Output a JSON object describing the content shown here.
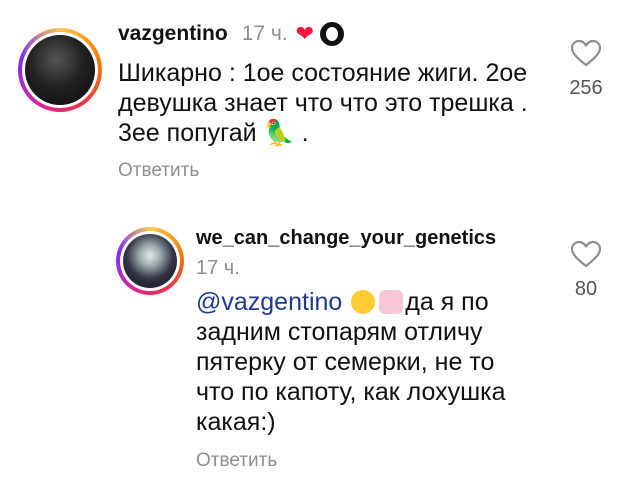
{
  "comments": [
    {
      "username": "vazgentino",
      "time": "17 ч.",
      "text_line1": "Шикарно : 1ое состояние жиги. 2ое",
      "text_line2": "девушка знает что что это трешка   .",
      "text_line3": "3ее попугай 🦜 .",
      "reply_label": "Ответить",
      "likes": "256",
      "badges": [
        "heart-icon",
        "face-icon"
      ]
    },
    {
      "username": "we_can_change_your_genetics",
      "time": "17 ч.",
      "mention": "@vazgentino",
      "text_after_mention": "да я по",
      "text_line2": "задним стопарям отличу",
      "text_line3": "пятерку от семерки, не то",
      "text_line4": "что по капоту, как лохушка",
      "text_line5": "какая:)",
      "reply_label": "Ответить",
      "likes": "80"
    }
  ],
  "colors": {
    "mention": "#1f3b8c",
    "muted": "#8e8e8e",
    "heart_badge": "#ed1c3a"
  }
}
